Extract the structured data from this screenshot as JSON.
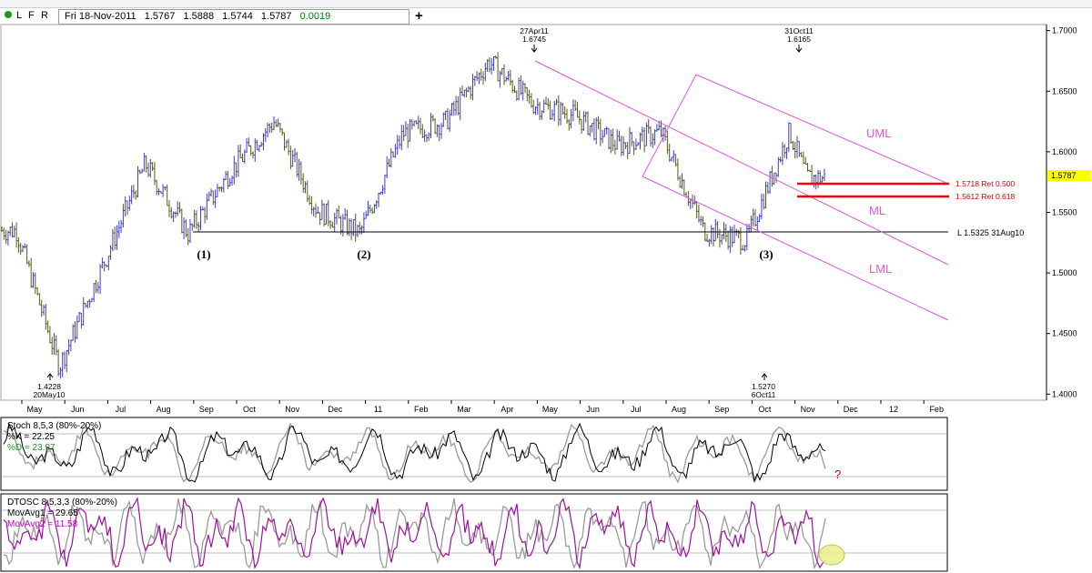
{
  "toolbar": {
    "dot_icon": "green-dot",
    "l_label": "L",
    "f_label": "F",
    "r_label": "R",
    "quote": {
      "date": "Fri 18-Nov-2011",
      "open": "1.5767",
      "high": "1.5888",
      "low": "1.5744",
      "close": "1.5787",
      "change": "0.0019"
    },
    "add_button": "+"
  },
  "colors": {
    "up_bar": "#3a3ae6",
    "down_bar": "#5c5c14",
    "channel": "#e055e0",
    "retracement": "#ff0000",
    "price_highlight": "#ffff00",
    "stoch_k": "#000000",
    "stoch_d": "#9a9a9a",
    "dtosc_1": "#a010a0",
    "dtosc_2": "#9a9a9a",
    "marker_circle": "#e8f08a"
  },
  "chart_data": [
    {
      "type": "ohlc",
      "price_axis": {
        "ticks": [
          "1.7000",
          "1.6500",
          "1.6000",
          "1.5500",
          "1.5000",
          "1.4500",
          "1.4000"
        ],
        "range": [
          1.395,
          1.705
        ],
        "last_price_label": "1.5787"
      },
      "time_axis": [
        "May",
        "Jun",
        "Jul",
        "Aug",
        "Sep",
        "Oct",
        "Nov",
        "Dec",
        "11",
        "Feb",
        "Mar",
        "Apr",
        "May",
        "Jun",
        "Jul",
        "Aug",
        "Sep",
        "Oct",
        "Nov",
        "Dec",
        "12",
        "Feb"
      ],
      "close_path": [
        {
          "x": "May",
          "y": 1.535
        },
        {
          "x": "Jun",
          "y": 1.4228
        },
        {
          "x": "Jul",
          "y": 1.505
        },
        {
          "x": "Aug",
          "y": 1.59
        },
        {
          "x": "Sep",
          "y": 1.5325
        },
        {
          "x": "Oct",
          "y": 1.585
        },
        {
          "x": "Nov",
          "y": 1.625
        },
        {
          "x": "Dec",
          "y": 1.552
        },
        {
          "x": "11",
          "y": 1.533
        },
        {
          "x": "Feb",
          "y": 1.615
        },
        {
          "x": "Mar",
          "y": 1.625
        },
        {
          "x": "Apr",
          "y": 1.6745
        },
        {
          "x": "May",
          "y": 1.64
        },
        {
          "x": "Jun",
          "y": 1.63
        },
        {
          "x": "Jul",
          "y": 1.605
        },
        {
          "x": "Aug",
          "y": 1.6165
        },
        {
          "x": "Sep",
          "y": 1.535
        },
        {
          "x": "Oct",
          "y": 1.527
        },
        {
          "x": "Nov",
          "y": 1.6165
        },
        {
          "x": "Nov",
          "y": 1.5787
        }
      ],
      "annotations": {
        "high1": {
          "date": "27Apr11",
          "price": "1.6745"
        },
        "high2": {
          "date": "31Oct11",
          "price": "1.6165"
        },
        "low1": {
          "price": "1.4228",
          "date": "20May10"
        },
        "low2": {
          "price": "1.5270",
          "date": "6Oct11"
        },
        "wave1": "(1)",
        "wave2": "(2)",
        "wave3": "(3)",
        "support_line": "L 1.5325 31Aug10",
        "uml": "UML",
        "ml": "ML",
        "lml": "LML",
        "ret1": "1.5718 Ret 0.500",
        "ret2": "1.5612 Ret 0.618"
      }
    },
    {
      "type": "line",
      "title": "Stoch 8,5,3 (80%-20%)",
      "series": [
        {
          "name": "%K",
          "value_label": "%K = 22.25"
        },
        {
          "name": "%D",
          "value_label": "%D = 23.97"
        }
      ],
      "levels": [
        80,
        20
      ],
      "question_mark": "?"
    },
    {
      "type": "line",
      "title": "DTOSC 8,5,3,3 (80%-20%)",
      "series": [
        {
          "name": "MovAvg1",
          "value_label": "MovAvg1 = 29.65"
        },
        {
          "name": "MovAvg2",
          "value_label": "MovAvg2 = 11.58"
        }
      ],
      "levels": [
        80,
        20
      ]
    }
  ]
}
